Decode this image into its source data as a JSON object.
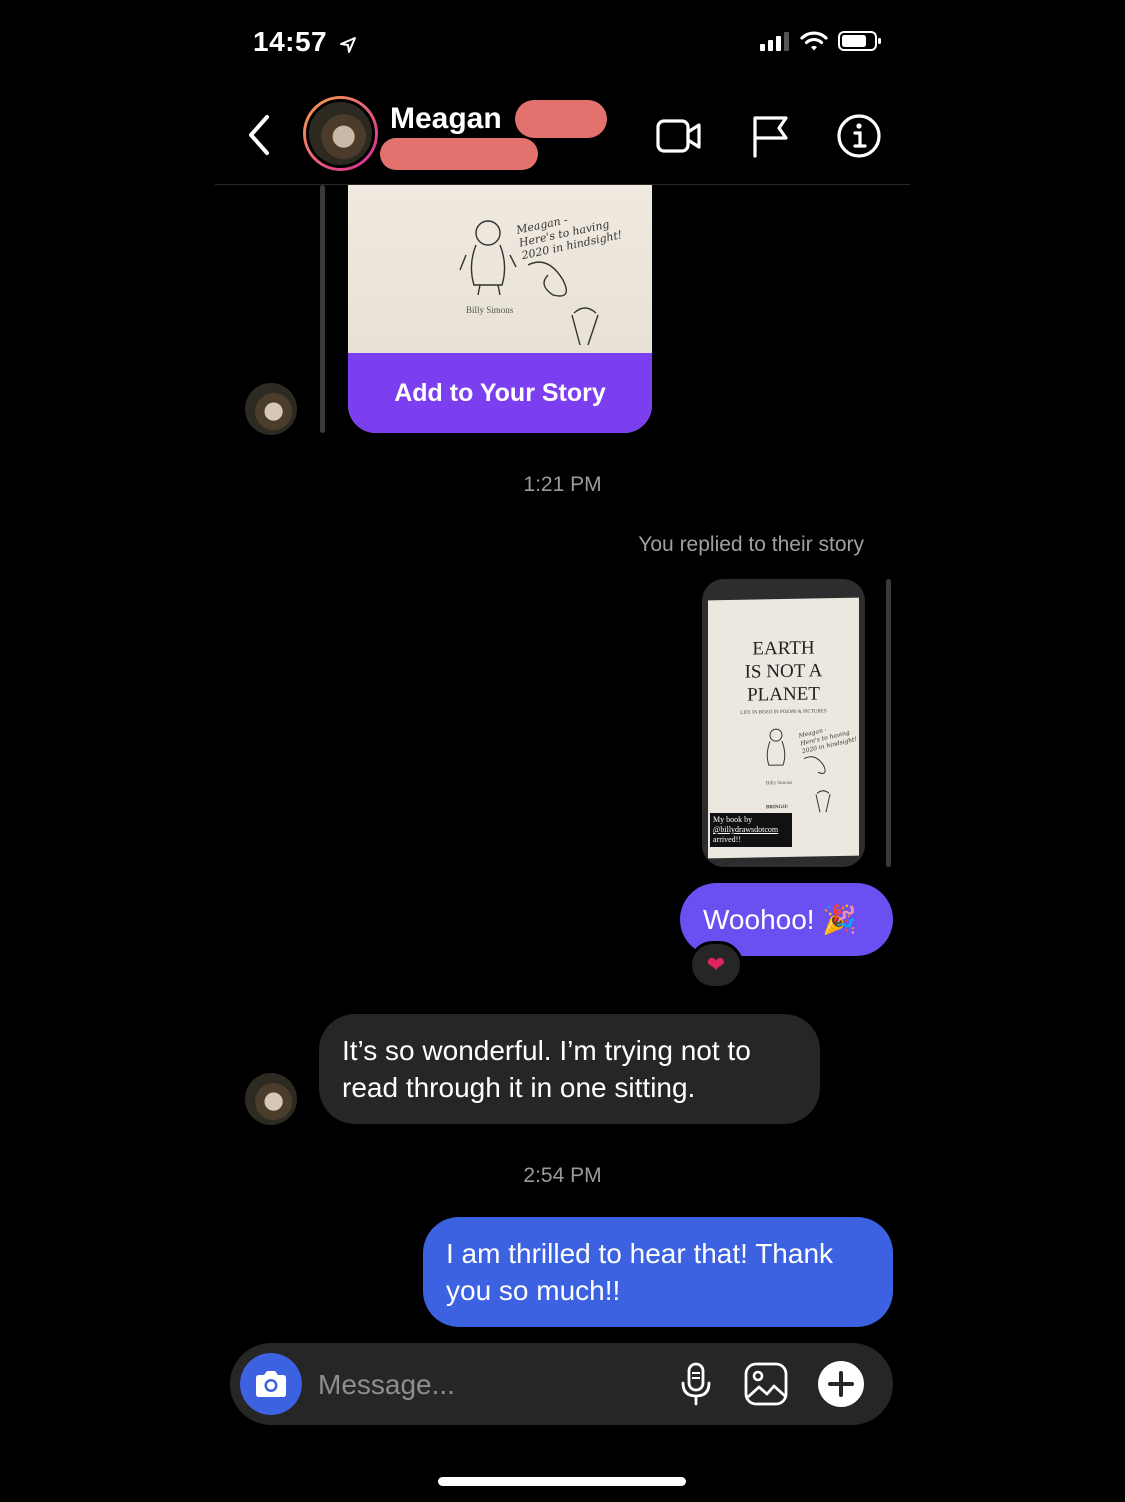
{
  "status_bar": {
    "time": "14:57",
    "location_icon": "location-arrow-icon"
  },
  "header": {
    "contact_name": "Meagan",
    "icons": [
      "back-chevron-icon",
      "video-call-icon",
      "flag-icon",
      "info-icon"
    ]
  },
  "story_1": {
    "button_label": "Add to Your Story",
    "inscription": [
      "Meagan -",
      "Here's to having",
      "2020 in hindsight!"
    ],
    "author_caption": "Billy Simons"
  },
  "timestamp_1": "1:21 PM",
  "reply_label": "You replied to their story",
  "story_2": {
    "title_lines": [
      "EARTH",
      "IS NOT A",
      "PLANET"
    ],
    "subtitle": "LIFE IN BOZO IN POEMS & PICTURES",
    "author": "Billy Simons",
    "publisher": "BRINGO!",
    "sticker_lines": [
      "My book by",
      "@billydrawsdotcom",
      "arrived!!"
    ]
  },
  "messages": {
    "sent_1": "Woohoo! 🎉",
    "reaction": "❤",
    "received_1": "It’s so wonderful. I’m trying not to read through it in one sitting.",
    "sent_2": "I am thrilled to hear that! Thank you so much!!"
  },
  "timestamp_2": "2:54 PM",
  "composer": {
    "placeholder": "Message...",
    "icons": [
      "camera-icon",
      "microphone-icon",
      "gallery-icon",
      "plus-icon"
    ]
  },
  "colors": {
    "sent_bubble_purple": "#6c4ff0",
    "sent_bubble_blue": "#3d62e1",
    "received_bubble": "#262626",
    "story_button": "#7b3ff0",
    "redaction": "#e3716e"
  }
}
